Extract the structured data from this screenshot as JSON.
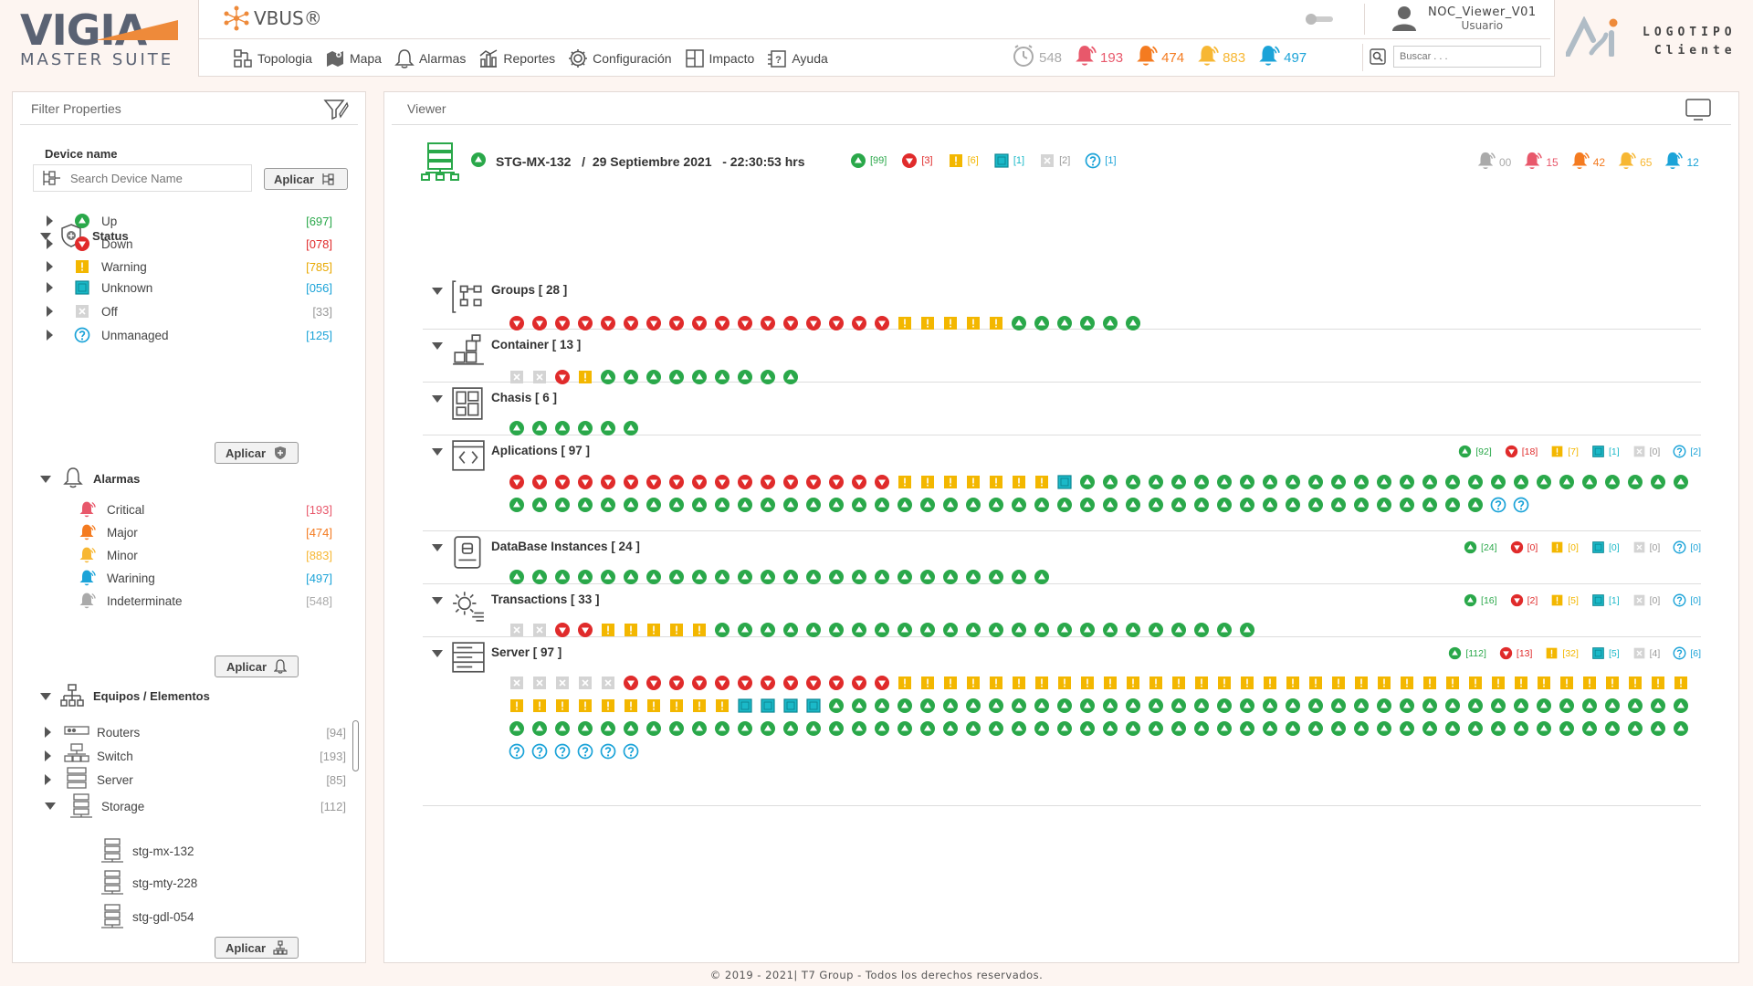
{
  "brand": {
    "name": "VIGIA",
    "suite": "MASTER SUITE",
    "product": "VBUS®"
  },
  "menu": [
    {
      "label": "Topologia",
      "icon": "topology-icon"
    },
    {
      "label": "Mapa",
      "icon": "map-icon"
    },
    {
      "label": "Alarmas",
      "icon": "bell-icon"
    },
    {
      "label": "Reportes",
      "icon": "reports-icon"
    },
    {
      "label": "Configuración",
      "icon": "gear-icon"
    },
    {
      "label": "Impacto",
      "icon": "impact-icon"
    },
    {
      "label": "Ayuda",
      "icon": "help-icon"
    }
  ],
  "user": {
    "name": "NOC_Viewer_V01",
    "role": "Usuario"
  },
  "header_counters": [
    {
      "value": "548",
      "color": "#aaaaaa",
      "icon": "clock-icon"
    },
    {
      "value": "193",
      "color": "#e8586b",
      "icon": "bell-icon"
    },
    {
      "value": "474",
      "color": "#f47b20",
      "icon": "bell-icon"
    },
    {
      "value": "883",
      "color": "#f7b733",
      "icon": "bell-icon"
    },
    {
      "value": "497",
      "color": "#1ba3d8",
      "icon": "bell-icon"
    }
  ],
  "search": {
    "placeholder": "Buscar . . ."
  },
  "client_logo": {
    "line1": "LOGOTIPO",
    "line2": "Cliente"
  },
  "filter": {
    "title": "Filter Properties",
    "device_name_label": "Device name",
    "device_placeholder": "Search Device Name",
    "apply": "Aplicar",
    "status_title": "Status",
    "status": [
      {
        "label": "Up",
        "count": "[697]",
        "type": "up",
        "color": "#2aa84a"
      },
      {
        "label": "Down",
        "count": "[078]",
        "type": "down",
        "color": "#e02b2b"
      },
      {
        "label": "Warning",
        "count": "[785]",
        "type": "warn",
        "color": "#e8a800"
      },
      {
        "label": "Unknown",
        "count": "[056]",
        "type": "unknown",
        "color": "#1ba3d8"
      },
      {
        "label": "Off",
        "count": "[33]",
        "type": "off",
        "color": "#999999"
      },
      {
        "label": "Unmanaged",
        "count": "[125]",
        "type": "unmanaged",
        "color": "#1ba3d8"
      }
    ],
    "alarms_title": "Alarmas",
    "alarms": [
      {
        "label": "Critical",
        "count": "[193]",
        "color": "#e8586b"
      },
      {
        "label": "Major",
        "count": "[474]",
        "color": "#f47b20"
      },
      {
        "label": "Minor",
        "count": "[883]",
        "color": "#f7b733"
      },
      {
        "label": "Warining",
        "count": "[497]",
        "color": "#1ba3d8"
      },
      {
        "label": "Indeterminate",
        "count": "[548]",
        "color": "#aaaaaa"
      }
    ],
    "equipment_title": "Equipos / Elementos",
    "equipment": [
      {
        "label": "Routers",
        "count": "[94]"
      },
      {
        "label": "Switch",
        "count": "[193]"
      },
      {
        "label": "Server",
        "count": "[85]"
      },
      {
        "label": "Storage",
        "count": "[112]"
      }
    ],
    "storage_items": [
      "stg-mx-132",
      "stg-mty-228",
      "stg-gdl-054"
    ]
  },
  "viewer": {
    "title": "Viewer",
    "device": "STG-MX-132",
    "date": "29 Septiembre 2021",
    "time": "- 22:30:53 hrs",
    "status_summary": [
      {
        "type": "up",
        "value": "[99]"
      },
      {
        "type": "down",
        "value": "[3]"
      },
      {
        "type": "warn",
        "value": "[6]"
      },
      {
        "type": "unknown",
        "value": "[1]"
      },
      {
        "type": "off",
        "value": "[2]"
      },
      {
        "type": "unmanaged",
        "value": "[1]"
      }
    ],
    "alarm_summary": [
      {
        "value": "00",
        "color": "#aaaaaa"
      },
      {
        "value": "15",
        "color": "#e8586b"
      },
      {
        "value": "42",
        "color": "#f47b20"
      },
      {
        "value": "65",
        "color": "#f7b733"
      },
      {
        "value": "12",
        "color": "#1ba3d8"
      }
    ],
    "sections": [
      {
        "title": "Groups [ 28 ]",
        "icon": "groups-icon",
        "composition": [
          [
            "down",
            17
          ],
          [
            "warn",
            5
          ],
          [
            "up",
            6
          ]
        ],
        "summary": []
      },
      {
        "title": "Container [ 13 ]",
        "icon": "container-icon",
        "composition": [
          [
            "off",
            2
          ],
          [
            "down",
            1
          ],
          [
            "warn",
            1
          ],
          [
            "up",
            9
          ]
        ],
        "summary": []
      },
      {
        "title": "Chasis [ 6 ]",
        "icon": "chassis-icon",
        "composition": [
          [
            "up",
            6
          ]
        ],
        "summary": []
      },
      {
        "title": "Aplications [ 97 ]",
        "icon": "applications-icon",
        "composition": [
          [
            "down",
            17
          ],
          [
            "warn",
            7
          ],
          [
            "unknown",
            1
          ],
          [
            "up",
            70
          ],
          [
            "unmanaged",
            2
          ]
        ],
        "summary": [
          [
            "up",
            "[92]"
          ],
          [
            "down",
            "[18]"
          ],
          [
            "warn",
            "[7]"
          ],
          [
            "unknown",
            "[1]"
          ],
          [
            "off",
            "[0]"
          ],
          [
            "unmanaged",
            "[2]"
          ]
        ]
      },
      {
        "title": "DataBase Instances [ 24 ]",
        "icon": "database-icon",
        "composition": [
          [
            "up",
            24
          ]
        ],
        "summary": [
          [
            "up",
            "[24]"
          ],
          [
            "down",
            "[0]"
          ],
          [
            "warn",
            "[0]"
          ],
          [
            "unknown",
            "[0]"
          ],
          [
            "off",
            "[0]"
          ],
          [
            "unmanaged",
            "[0]"
          ]
        ]
      },
      {
        "title": "Transactions [ 33 ]",
        "icon": "transactions-icon",
        "composition": [
          [
            "off",
            2
          ],
          [
            "down",
            2
          ],
          [
            "warn",
            5
          ],
          [
            "up",
            24
          ]
        ],
        "summary": [
          [
            "up",
            "[16]"
          ],
          [
            "down",
            "[2]"
          ],
          [
            "warn",
            "[5]"
          ],
          [
            "unknown",
            "[1]"
          ],
          [
            "off",
            "[0]"
          ],
          [
            "unmanaged",
            "[0]"
          ]
        ]
      },
      {
        "title": "Server [ 97 ]",
        "icon": "server-icon",
        "composition": [
          [
            "off",
            5
          ],
          [
            "down",
            12
          ],
          [
            "warn",
            45
          ],
          [
            "unknown",
            4
          ],
          [
            "up",
            90
          ],
          [
            "unmanaged",
            6
          ]
        ],
        "summary": [
          [
            "up",
            "[112]"
          ],
          [
            "down",
            "[13]"
          ],
          [
            "warn",
            "[32]"
          ],
          [
            "unknown",
            "[5]"
          ],
          [
            "off",
            "[4]"
          ],
          [
            "unmanaged",
            "[6]"
          ]
        ]
      }
    ]
  },
  "footer": "© 2019 - 2021| T7 Group - Todos los derechos reservados."
}
